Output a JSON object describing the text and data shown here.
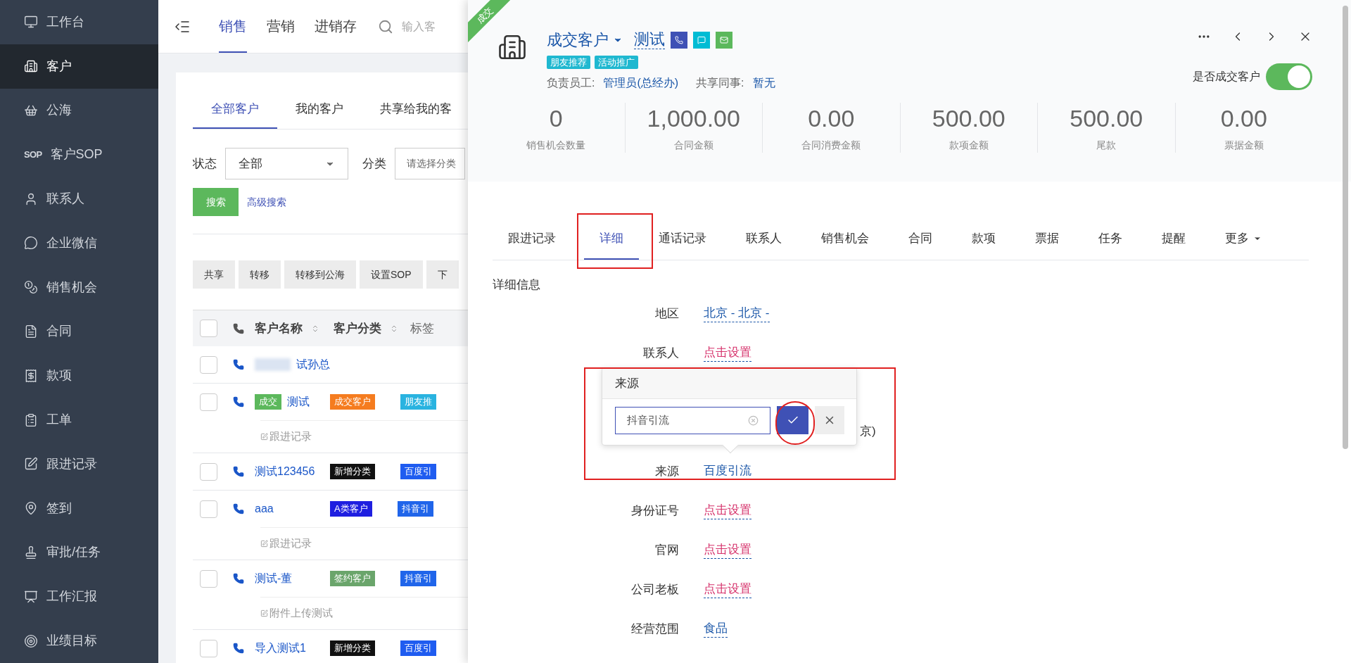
{
  "sidebar": {
    "items": [
      {
        "label": "工作台",
        "selected": false
      },
      {
        "label": "客户",
        "selected": true
      },
      {
        "label": "公海",
        "selected": false
      },
      {
        "label": "客户SOP",
        "selected": false,
        "icon_text": "SOP"
      },
      {
        "label": "联系人",
        "selected": false
      },
      {
        "label": "企业微信",
        "selected": false
      },
      {
        "label": "销售机会",
        "selected": false
      },
      {
        "label": "合同",
        "selected": false
      },
      {
        "label": "款项",
        "selected": false
      },
      {
        "label": "工单",
        "selected": false
      },
      {
        "label": "跟进记录",
        "selected": false
      },
      {
        "label": "签到",
        "selected": false
      },
      {
        "label": "审批/任务",
        "selected": false
      },
      {
        "label": "工作汇报",
        "selected": false
      },
      {
        "label": "业绩目标",
        "selected": false
      }
    ]
  },
  "topnav": {
    "tabs": [
      {
        "label": "销售",
        "selected": true
      },
      {
        "label": "营销",
        "selected": false
      },
      {
        "label": "进销存",
        "selected": false
      }
    ],
    "search": {
      "placeholder": "输入客"
    }
  },
  "customer_tabs": [
    {
      "label": "全部客户",
      "selected": true
    },
    {
      "label": "我的客户",
      "selected": false
    },
    {
      "label": "共享给我的客",
      "selected": false
    }
  ],
  "filters": [
    {
      "label": "状态",
      "value": "全部"
    },
    {
      "label": "分类",
      "placeholder": "请选择分类"
    }
  ],
  "search_button": "搜索",
  "advanced_search": "高级搜索",
  "actions": [
    "共享",
    "转移",
    "转移到公海",
    "设置SOP",
    "下"
  ],
  "table": {
    "all_checked": false,
    "columns": [
      "客户名称",
      "客户分类",
      "标签"
    ],
    "rows": [
      {
        "name": "试孙总",
        "blurred": true,
        "checked": false
      },
      {
        "name": "测试",
        "checked": false,
        "status": "成交",
        "category": {
          "label": "成交客户",
          "color": "#f57c1f"
        },
        "tag": {
          "label": "朋友推",
          "color": "#29b3e0"
        },
        "note": "跟进记录"
      },
      {
        "name": "测试123456",
        "checked": false,
        "category": {
          "label": "新增分类",
          "color": "#111111"
        },
        "tag": {
          "label": "百度引",
          "color": "#1f5cf0"
        }
      },
      {
        "name": "aaa",
        "checked": false,
        "category": {
          "label": "A类客户",
          "color": "#1f1fe0"
        },
        "tag": {
          "label": "抖音引",
          "color": "#2065ea"
        },
        "note": "跟进记录"
      },
      {
        "name": "测试-董",
        "checked": false,
        "category": {
          "label": "签约客户",
          "color": "#6aa56b"
        },
        "tag": {
          "label": "抖音引",
          "color": "#2065ea"
        },
        "note": "附件上传测试"
      },
      {
        "name": "导入测试1",
        "checked": false,
        "category": {
          "label": "新增分类",
          "color": "#111111"
        },
        "tag": {
          "label": "百度引",
          "color": "#1f5cf0"
        }
      }
    ]
  },
  "detail": {
    "ribbon": "成交",
    "category": "成交客户",
    "name": "测试",
    "tags": [
      "朋友推荐",
      "活动推广"
    ],
    "owner_label": "负责员工:",
    "owner": "管理员(总经办)",
    "shared_label": "共享同事:",
    "shared": "暂无",
    "deal_toggle": {
      "label": "是否成交客户",
      "on": true
    },
    "stats": [
      {
        "value": "0",
        "label": "销售机会数量"
      },
      {
        "value": "1,000.00",
        "label": "合同金额"
      },
      {
        "value": "0.00",
        "label": "合同消费金额"
      },
      {
        "value": "500.00",
        "label": "款项金额"
      },
      {
        "value": "500.00",
        "label": "尾款"
      },
      {
        "value": "0.00",
        "label": "票据金额"
      }
    ],
    "tabs": [
      {
        "label": "跟进记录",
        "selected": false
      },
      {
        "label": "详细",
        "selected": true
      },
      {
        "label": "通话记录",
        "selected": false
      },
      {
        "label": "联系人",
        "selected": false
      },
      {
        "label": "销售机会",
        "selected": false
      },
      {
        "label": "合同",
        "selected": false
      },
      {
        "label": "款项",
        "selected": false
      },
      {
        "label": "票据",
        "selected": false
      },
      {
        "label": "任务",
        "selected": false
      },
      {
        "label": "提醒",
        "selected": false
      },
      {
        "label": "更多",
        "selected": false
      }
    ],
    "section_title": "详细信息",
    "fields": [
      {
        "label": "地区",
        "value": "北京 - 北京 -",
        "kind": "set"
      },
      {
        "label": "联系人",
        "value": "点击设置",
        "kind": "unset"
      },
      {
        "value": "京)",
        "kind": "covered"
      },
      {
        "label": "来源",
        "value": "百度引流",
        "kind": "set"
      },
      {
        "label": "身份证号",
        "value": "点击设置",
        "kind": "unset"
      },
      {
        "label": "官网",
        "value": "点击设置",
        "kind": "unset"
      },
      {
        "label": "公司老板",
        "value": "点击设置",
        "kind": "unset"
      },
      {
        "label": "经营范围",
        "value": "食品",
        "kind": "set"
      }
    ],
    "popup": {
      "title": "来源",
      "value": "抖音引流"
    }
  }
}
